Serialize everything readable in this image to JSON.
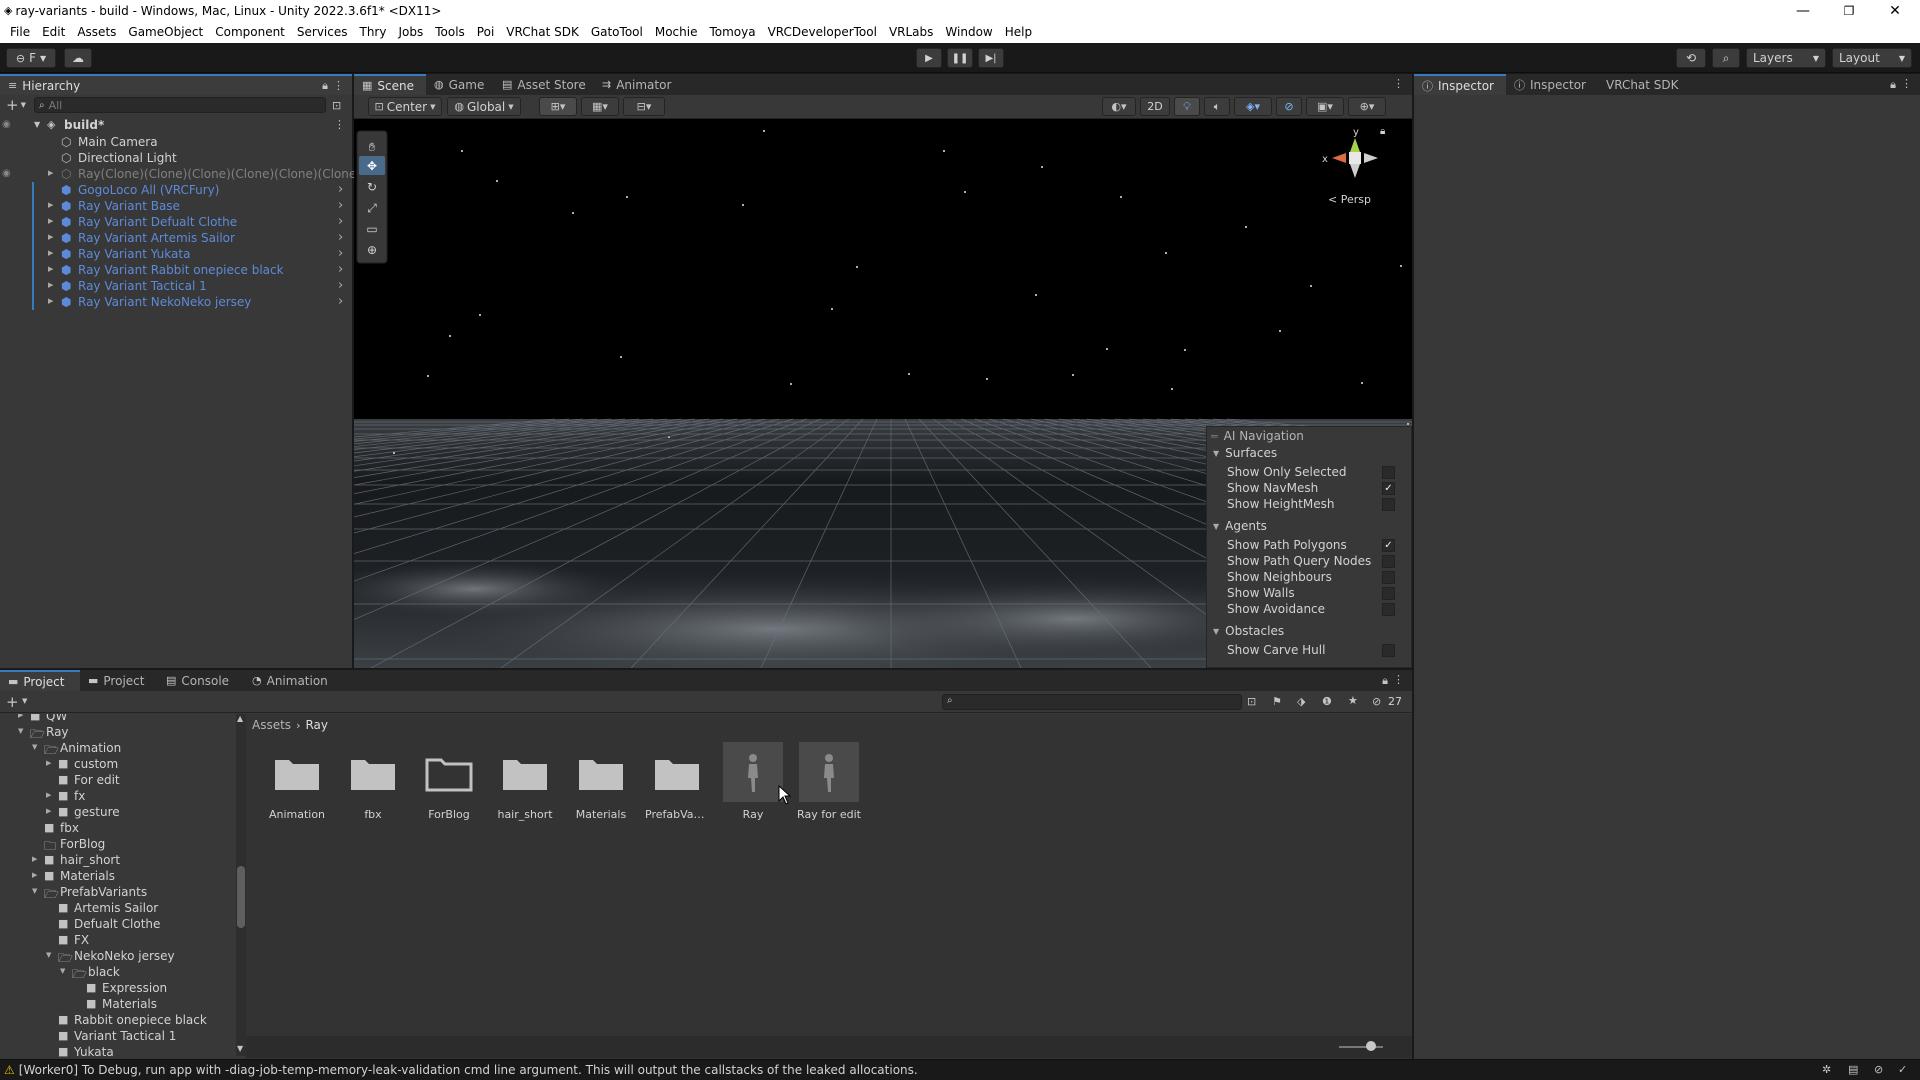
{
  "window": {
    "title": "ray-variants - build - Windows, Mac, Linux - Unity 2022.3.6f1* <DX11>",
    "minimize": "—",
    "maximize": "❐",
    "close": "✕"
  },
  "menu": [
    "File",
    "Edit",
    "Assets",
    "GameObject",
    "Component",
    "Services",
    "Thry",
    "Jobs",
    "Tools",
    "Poi",
    "VRChat SDK",
    "GatoTool",
    "Mochie",
    "Tomoya",
    "VRCDeveloperTool",
    "VRLabs",
    "Window",
    "Help"
  ],
  "toolbar": {
    "account": "F",
    "layers_label": "Layers",
    "layout_label": "Layout"
  },
  "hierarchy": {
    "tab": "Hierarchy",
    "search_placeholder": "All",
    "scene_name": "build*",
    "items": [
      {
        "label": "Main Camera",
        "prefab": false,
        "expand": false
      },
      {
        "label": "Directional Light",
        "prefab": false,
        "expand": false
      },
      {
        "label": "Ray(Clone)(Clone)(Clone)(Clone)(Clone)(Clone)",
        "prefab": false,
        "expand": true,
        "dim": true
      },
      {
        "label": "GogoLoco All (VRCFury)",
        "prefab": true,
        "expand": false
      },
      {
        "label": "Ray Variant Base",
        "prefab": true,
        "expand": true
      },
      {
        "label": "Ray Variant Defualt Clothe",
        "prefab": true,
        "expand": true
      },
      {
        "label": "Ray Variant Artemis Sailor",
        "prefab": true,
        "expand": true
      },
      {
        "label": "Ray Variant Yukata",
        "prefab": true,
        "expand": true
      },
      {
        "label": "Ray Variant Rabbit onepiece black",
        "prefab": true,
        "expand": true
      },
      {
        "label": "Ray Variant Tactical 1",
        "prefab": true,
        "expand": true
      },
      {
        "label": "Ray Variant NekoNeko jersey",
        "prefab": true,
        "expand": true
      }
    ]
  },
  "scene": {
    "tabs": [
      "Scene",
      "Game",
      "Asset Store",
      "Animator"
    ],
    "pivot": "Center",
    "space": "Global",
    "mode_2d": "2D",
    "gizmo_y": "y",
    "gizmo_x": "x",
    "persp": "Persp"
  },
  "ai_nav": {
    "title": "AI Navigation",
    "sections": [
      {
        "name": "Surfaces",
        "items": [
          {
            "label": "Show Only Selected",
            "checked": false
          },
          {
            "label": "Show NavMesh",
            "checked": true
          },
          {
            "label": "Show HeightMesh",
            "checked": false
          }
        ]
      },
      {
        "name": "Agents",
        "items": [
          {
            "label": "Show Path Polygons",
            "checked": true
          },
          {
            "label": "Show Path Query Nodes",
            "checked": false
          },
          {
            "label": "Show Neighbours",
            "checked": false
          },
          {
            "label": "Show Walls",
            "checked": false
          },
          {
            "label": "Show Avoidance",
            "checked": false
          }
        ]
      },
      {
        "name": "Obstacles",
        "items": [
          {
            "label": "Show Carve Hull",
            "checked": false
          }
        ]
      }
    ]
  },
  "inspector": {
    "tabs": [
      "Inspector",
      "Inspector",
      "VRChat SDK"
    ]
  },
  "project": {
    "tabs": [
      "Project",
      "Project",
      "Console",
      "Animation"
    ],
    "breadcrumb": [
      "Assets",
      "Ray"
    ],
    "hidden_count": "27",
    "tree": [
      {
        "label": "QW",
        "indent": 1,
        "arrow": "right",
        "open": false
      },
      {
        "label": "Ray",
        "indent": 1,
        "arrow": "down",
        "open": true
      },
      {
        "label": "Animation",
        "indent": 2,
        "arrow": "down",
        "open": true
      },
      {
        "label": "custom",
        "indent": 3,
        "arrow": "right",
        "open": false
      },
      {
        "label": "For edit",
        "indent": 3,
        "arrow": "",
        "open": false
      },
      {
        "label": "fx",
        "indent": 3,
        "arrow": "right",
        "open": false
      },
      {
        "label": "gesture",
        "indent": 3,
        "arrow": "right",
        "open": false
      },
      {
        "label": "fbx",
        "indent": 2,
        "arrow": "",
        "open": false
      },
      {
        "label": "ForBlog",
        "indent": 2,
        "arrow": "",
        "open": false,
        "empty": true
      },
      {
        "label": "hair_short",
        "indent": 2,
        "arrow": "right",
        "open": false
      },
      {
        "label": "Materials",
        "indent": 2,
        "arrow": "right",
        "open": false
      },
      {
        "label": "PrefabVariants",
        "indent": 2,
        "arrow": "down",
        "open": true
      },
      {
        "label": "Artemis Sailor",
        "indent": 3,
        "arrow": "",
        "open": false
      },
      {
        "label": "Defualt Clothe",
        "indent": 3,
        "arrow": "",
        "open": false
      },
      {
        "label": "FX",
        "indent": 3,
        "arrow": "",
        "open": false
      },
      {
        "label": "NekoNeko jersey",
        "indent": 3,
        "arrow": "down",
        "open": true
      },
      {
        "label": "black",
        "indent": 4,
        "arrow": "down",
        "open": true
      },
      {
        "label": "Expression",
        "indent": 5,
        "arrow": "",
        "open": false
      },
      {
        "label": "Materials",
        "indent": 5,
        "arrow": "",
        "open": false
      },
      {
        "label": "Rabbit onepiece black",
        "indent": 3,
        "arrow": "",
        "open": false
      },
      {
        "label": "Variant Tactical 1",
        "indent": 3,
        "arrow": "",
        "open": false
      },
      {
        "label": "Yukata",
        "indent": 3,
        "arrow": "",
        "open": false
      }
    ],
    "assets": [
      {
        "label": "Animation",
        "type": "folder"
      },
      {
        "label": "fbx",
        "type": "folder"
      },
      {
        "label": "ForBlog",
        "type": "folder-empty"
      },
      {
        "label": "hair_short",
        "type": "folder"
      },
      {
        "label": "Materials",
        "type": "folder"
      },
      {
        "label": "PrefabVari...",
        "type": "folder"
      },
      {
        "label": "Ray",
        "type": "model"
      },
      {
        "label": "Ray for edit",
        "type": "model"
      }
    ]
  },
  "status": {
    "message": "[Worker0] To Debug, run app with -diag-job-temp-memory-leak-validation cmd line argument. This will output the callstacks of the leaked allocations."
  },
  "colors": {
    "accent": "#3a79bb",
    "prefab": "#5d8ad8",
    "warning": "#f0c000"
  }
}
